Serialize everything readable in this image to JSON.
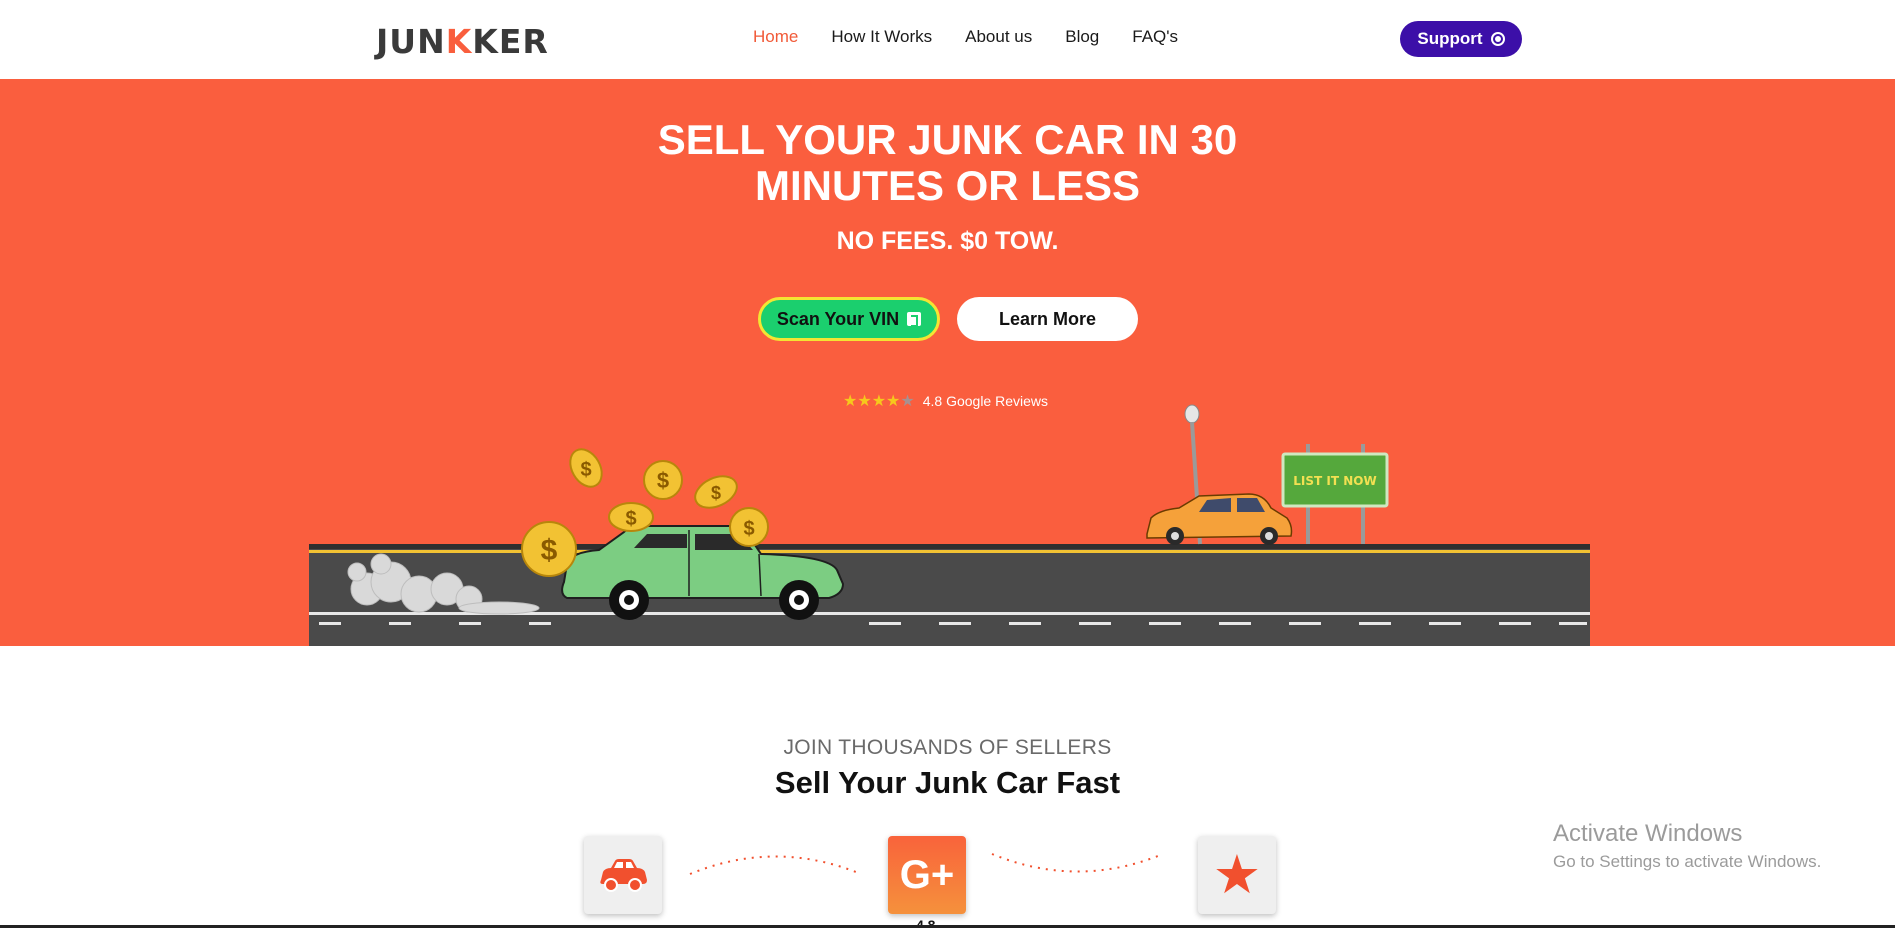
{
  "header": {
    "logo": {
      "part1": "JUN",
      "part2": "K",
      "part3": "KER"
    },
    "nav": [
      {
        "label": "Home",
        "active": true
      },
      {
        "label": "How It Works",
        "active": false
      },
      {
        "label": "About us",
        "active": false
      },
      {
        "label": "Blog",
        "active": false
      },
      {
        "label": "FAQ's",
        "active": false
      }
    ],
    "support_label": "Support"
  },
  "hero": {
    "headline_line1": "SELL YOUR JUNK CAR IN 30",
    "headline_line2": "MINUTES OR LESS",
    "subheadline": "NO FEES. $0 TOW.",
    "scan_button_label": "Scan Your VIN",
    "learn_button_label": "Learn More",
    "reviews": {
      "rating": 4.8,
      "stars_filled": 4,
      "stars_total": 5,
      "text": "4.8 Google Reviews"
    },
    "sign_text": "LIST IT NOW",
    "background_color": "#fa5e3e"
  },
  "section": {
    "eyebrow": "JOIN THOUSANDS OF SELLERS",
    "title": "Sell Your Junk Car Fast",
    "tiles": [
      {
        "icon": "car-icon"
      },
      {
        "icon": "google-plus-icon",
        "label": "G+"
      },
      {
        "icon": "star-icon"
      }
    ],
    "peek_value": "4.8"
  },
  "os_overlay": {
    "line1": "Activate Windows",
    "line2": "Go to Settings to activate Windows."
  },
  "colors": {
    "accent": "#f15a38",
    "support": "#3c0fa8",
    "scan_button": "#1bcf6e",
    "scan_border": "#f4e532"
  }
}
